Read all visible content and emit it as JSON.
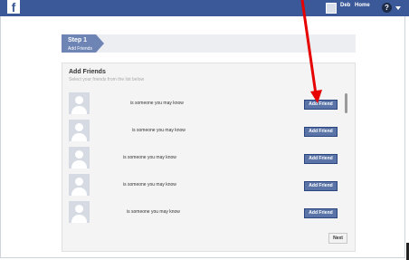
{
  "topbar": {
    "logo": "f",
    "user_name": "Deb",
    "home": "Home",
    "help": "?",
    "brand_color": "#3b5998"
  },
  "step": {
    "title": "Step 1",
    "subtitle": "Add Friends",
    "accent": "#6d84b4"
  },
  "panel": {
    "title": "Add Friends",
    "subtitle": "Select your friends from the list below"
  },
  "friends": [
    {
      "text": "is someone you may know",
      "button": "Add Friend"
    },
    {
      "text": "is someone you may know",
      "button": "Add Friend"
    },
    {
      "text": "is someone you may know",
      "button": "Add Friend"
    },
    {
      "text": "is someone you may know",
      "button": "Add Friend"
    },
    {
      "text": "is someone you may know",
      "button": "Add Friend"
    }
  ],
  "footer": {
    "next": "Next"
  },
  "annotation": {
    "arrow_color": "#e60000"
  }
}
